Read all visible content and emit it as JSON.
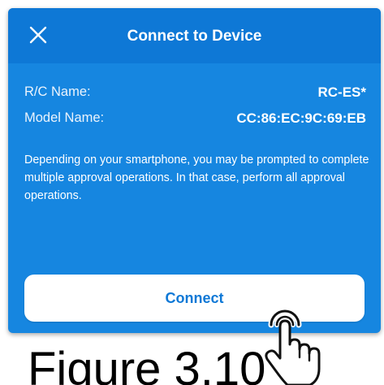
{
  "dialog": {
    "title": "Connect to Device",
    "close_icon": "close-icon",
    "rc_name_label": "R/C Name:",
    "rc_name_value": "RC-ES*",
    "model_name_label": "Model Name:",
    "model_name_value": "CC:86:EC:9C:69:EB",
    "note": "Depending on your smartphone, you may be prompted to complete multiple approval operations. In that case, perform all approval operations.",
    "connect_label": "Connect"
  },
  "caption": "Figure 3.10",
  "hand_icon": "tap-hand-icon",
  "colors": {
    "dialog_bg": "#1686e0",
    "header_bg": "#0e78d6",
    "button_text": "#0e78d6",
    "button_bg": "#ffffff"
  }
}
